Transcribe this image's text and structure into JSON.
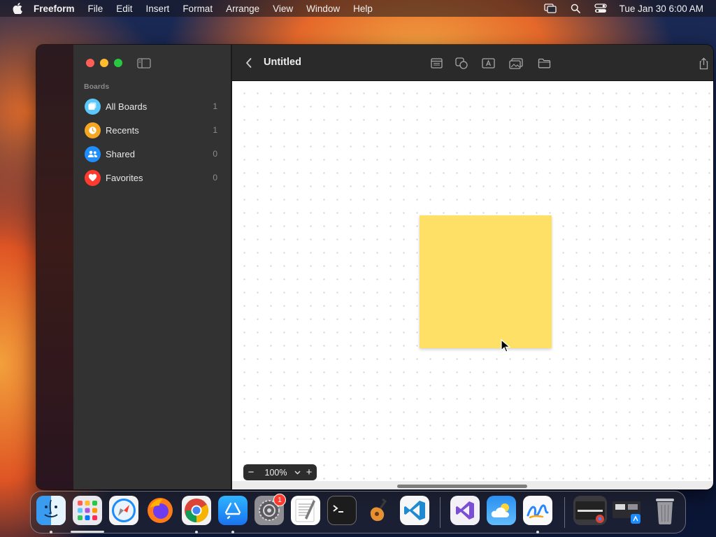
{
  "menubar": {
    "app_name": "Freeform",
    "items": [
      "File",
      "Edit",
      "Insert",
      "Format",
      "Arrange",
      "View",
      "Window",
      "Help"
    ],
    "clock": "Tue Jan 30  6:00 AM"
  },
  "sidebar": {
    "section_label": "Boards",
    "items": [
      {
        "label": "All Boards",
        "count": "1",
        "icon": "all-boards-icon",
        "color": "#5ac8fa"
      },
      {
        "label": "Recents",
        "count": "1",
        "icon": "clock-icon",
        "color": "#f5a623"
      },
      {
        "label": "Shared",
        "count": "0",
        "icon": "people-icon",
        "color": "#1f8fff"
      },
      {
        "label": "Favorites",
        "count": "0",
        "icon": "heart-icon",
        "color": "#ff3b30"
      }
    ]
  },
  "toolbar": {
    "title": "Untitled"
  },
  "canvas": {
    "sticky_color": "#ffe066",
    "zoom": {
      "minus": "−",
      "value": "100%",
      "plus": "+"
    }
  },
  "dock": {
    "apps": [
      "Finder",
      "Launchpad",
      "Safari",
      "Firefox",
      "Chrome",
      "App Store",
      "System Settings",
      "TextEdit",
      "Terminal",
      "GarageBand",
      "Visual Studio Code",
      "Visual Studio",
      "Weather",
      "Freeform"
    ],
    "settings_badge": "1"
  }
}
